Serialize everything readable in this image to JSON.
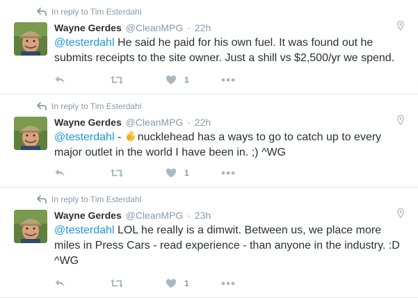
{
  "tweets": [
    {
      "reply_context": "In reply to Tim Esterdahl",
      "fullname": "Wayne Gerdes",
      "username": "@CleanMPG",
      "separator": "·",
      "time": "22h",
      "mention": "@testerdahl",
      "text_before_emoji": "",
      "text": " He said he paid for his own fuel. It was found out he submits receipts to the site owner. Just a shill vs $2,500/yr we spend.",
      "like_count": "1"
    },
    {
      "reply_context": "In reply to Tim Esterdahl",
      "fullname": "Wayne Gerdes",
      "username": "@CleanMPG",
      "separator": "·",
      "time": "22h",
      "mention": "@testerdahl",
      "text_before_emoji": " - ",
      "text": "nucklehead has a ways to go to catch up to every major outlet in the world I have been in. ;) ^WG",
      "like_count": "1"
    },
    {
      "reply_context": "In reply to Tim Esterdahl",
      "fullname": "Wayne Gerdes",
      "username": "@CleanMPG",
      "separator": "·",
      "time": "23h",
      "mention": "@testerdahl",
      "text_before_emoji": "",
      "text": " LOL he really is a dimwit. Between us, we place more miles in Press Cars - read experience - than anyone in the industry. :D ^WG",
      "like_count": "1"
    }
  ],
  "icons": {
    "reply": "reply-icon",
    "retweet": "retweet-icon",
    "like": "heart-icon",
    "more": "more-dots-icon",
    "geo": "location-pin-icon",
    "context": "reply-arrow-icon",
    "emoji": "ok-hand-emoji"
  },
  "colors": {
    "link": "#1b95e0",
    "muted": "#8899a6",
    "icon": "#aab8c2",
    "text": "#292f33",
    "divider": "#e1e8ed"
  }
}
